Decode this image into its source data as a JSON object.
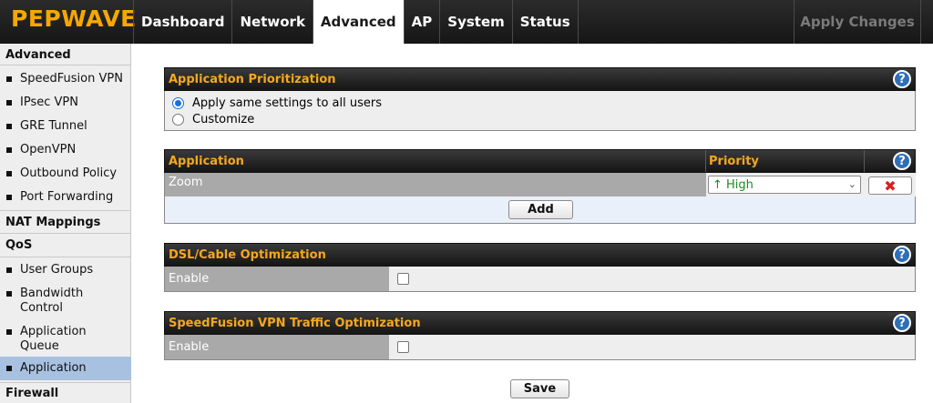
{
  "brand": {
    "logo_text": "PEPWAVE",
    "color": "#f6a800"
  },
  "nav": {
    "tabs": [
      {
        "label": "Dashboard",
        "active": false
      },
      {
        "label": "Network",
        "active": false
      },
      {
        "label": "Advanced",
        "active": true
      },
      {
        "label": "AP",
        "active": false
      },
      {
        "label": "System",
        "active": false
      },
      {
        "label": "Status",
        "active": false
      }
    ],
    "apply_changes": "Apply Changes"
  },
  "sidebar": {
    "section_advanced": "Advanced",
    "advanced_items": [
      "SpeedFusion VPN",
      "IPsec VPN",
      "GRE Tunnel",
      "OpenVPN",
      "Outbound Policy",
      "Port Forwarding"
    ],
    "section_nat": "NAT Mappings",
    "section_qos": "QoS",
    "qos_items": [
      "User Groups",
      "Bandwidth Control",
      "Application Queue",
      "Application"
    ],
    "active_item": "Application",
    "section_firewall": "Firewall"
  },
  "app_prioritization": {
    "title": "Application Prioritization",
    "options": [
      "Apply same settings to all users",
      "Customize"
    ],
    "selected": "Apply same settings to all users"
  },
  "app_table": {
    "headers": {
      "application": "Application",
      "priority": "Priority"
    },
    "rows": [
      {
        "application": "Zoom",
        "priority": "↑ High"
      }
    ],
    "add_label": "Add"
  },
  "dsl_optimization": {
    "title": "DSL/Cable Optimization",
    "enable_label": "Enable",
    "enabled": false
  },
  "speedfusion_optimization": {
    "title": "SpeedFusion VPN Traffic Optimization",
    "enable_label": "Enable",
    "enabled": false
  },
  "save_label": "Save",
  "icons": {
    "help": "help-icon",
    "delete": "delete-x-icon",
    "dropdown": "chevron-down-icon"
  },
  "colors": {
    "panel_title": "#f5a81e",
    "active_sidebar": "#a9c1e1",
    "priority_high": "#1d8a1d",
    "delete": "#d81e1e"
  }
}
